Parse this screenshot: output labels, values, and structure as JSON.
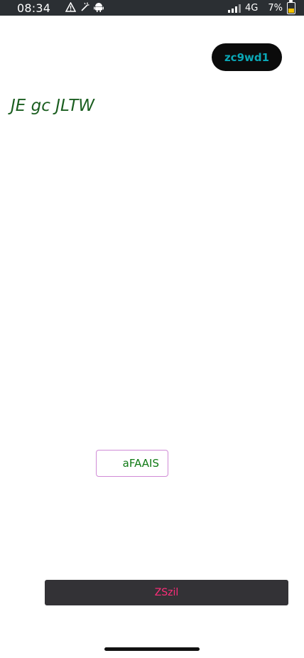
{
  "status_bar": {
    "time": "08:34",
    "network": "4G",
    "battery_percent": "7%",
    "icons_left": [
      "warning-icon",
      "wand-icon",
      "android-icon"
    ],
    "icons_right": [
      "signal-icon",
      "battery-icon"
    ]
  },
  "top_button": {
    "label": "zc9wd1"
  },
  "heading": {
    "text": "JE gc JLTW"
  },
  "middle_button": {
    "label": "aFAAIS"
  },
  "bottom_button": {
    "label": "ZSzil"
  },
  "colors": {
    "status_bar_bg": "#2b2f33",
    "top_button_text": "#0aa7b6",
    "heading_text": "#1b5e20",
    "middle_button_border": "#d08bd6",
    "middle_button_text": "#0f7a14",
    "bottom_button_bg": "#333236",
    "bottom_button_text": "#ff2d7a"
  }
}
